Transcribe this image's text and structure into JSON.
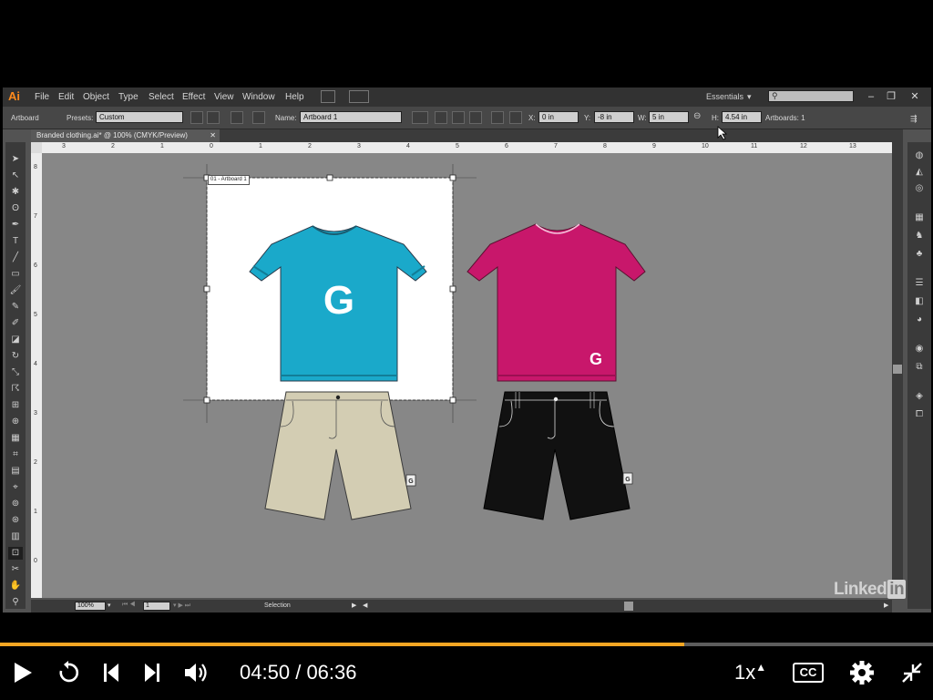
{
  "app": {
    "logo": "Ai",
    "menu": [
      "File",
      "Edit",
      "Object",
      "Type",
      "Select",
      "Effect",
      "View",
      "Window",
      "Help"
    ],
    "workspace": "Essentials",
    "window_buttons": [
      "–",
      "❐",
      "✕"
    ]
  },
  "control_bar": {
    "tool_label": "Artboard",
    "presets_label": "Presets:",
    "presets_value": "Custom",
    "name_label": "Name:",
    "name_value": "Artboard 1",
    "x_label": "X:",
    "x_value": "0 in",
    "y_label": "Y:",
    "y_value": "-8 in",
    "w_label": "W:",
    "w_value": "5 in",
    "h_label": "H:",
    "h_value": "4.54 in",
    "artboards_count": "Artboards: 1"
  },
  "document": {
    "tab_title": "Branded clothing.ai* @ 100% (CMYK/Preview)",
    "tab_close": "✕",
    "artboard_label": "01 - Artboard 1",
    "shirt_letter": "G"
  },
  "rulers": {
    "horizontal": [
      "3",
      "2",
      "1",
      "0",
      "1",
      "2",
      "3",
      "4",
      "5",
      "6",
      "7",
      "8",
      "9",
      "10",
      "11",
      "12",
      "13"
    ],
    "vertical": [
      "8",
      "7",
      "6",
      "5",
      "4",
      "3",
      "2",
      "1",
      "0"
    ]
  },
  "status_bar": {
    "zoom": "100%",
    "artboard_number": "1",
    "mode": "Selection"
  },
  "colors": {
    "shirt_blue": "#1aa9ca",
    "shirt_magenta": "#c8176b",
    "shorts_khaki": "#d3cdb3",
    "shorts_black": "#111111",
    "accent_progress": "#f5a623",
    "illustrator_orange": "#ff8a1c"
  },
  "player": {
    "current_time": "04:50",
    "separator": "/",
    "total_time": "06:36",
    "progress": 0.733,
    "speed": "1x",
    "cc_label": "CC",
    "watermark_main": "Linked",
    "watermark_in": "in"
  },
  "icons": [
    "play-icon",
    "replay-icon",
    "previous-icon",
    "next-icon",
    "volume-icon",
    "speed-caret-icon",
    "captions-icon",
    "settings-gear-icon",
    "exit-fullscreen-icon"
  ]
}
